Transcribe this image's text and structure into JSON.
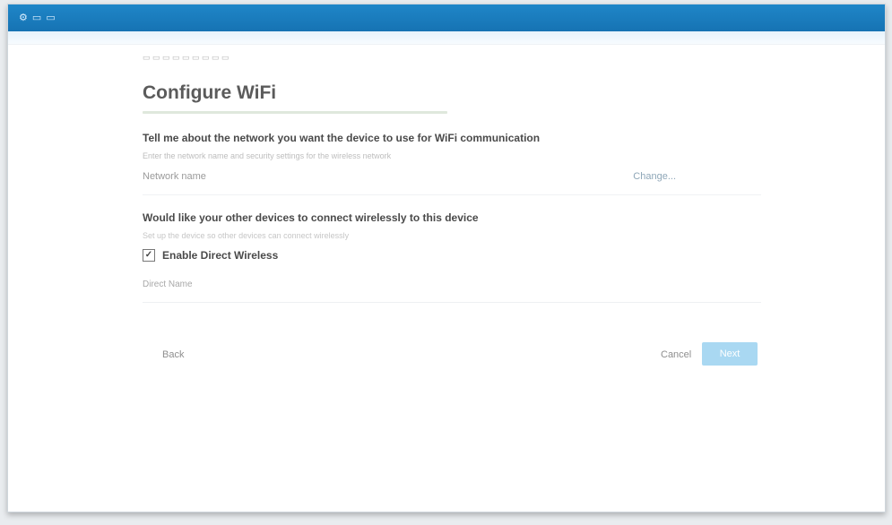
{
  "window": {
    "app_title": "⚙ ▭ ▭"
  },
  "breadcrumb": "▭ ▭ ▭ ▭ ▭ ▭ ▭ ▭ ▭",
  "page": {
    "title": "Configure WiFi"
  },
  "section1": {
    "heading": "Tell me about the network you want the device to use for WiFi communication",
    "description": "Enter the network name and security settings for the wireless network",
    "network_label": "Network name",
    "network_action": "Change..."
  },
  "section2": {
    "heading": "Would like your other devices to connect wirelessly to this device",
    "description": "Set up the device so other devices can connect wirelessly",
    "checkbox_label": "Enable Direct Wireless",
    "field_label": "Direct Name"
  },
  "footer": {
    "back_label": "Back",
    "cancel_label": "Cancel",
    "next_label": "Next"
  },
  "colors": {
    "titlebar": "#1f86c8",
    "primary_button": "#a9d8f2"
  }
}
